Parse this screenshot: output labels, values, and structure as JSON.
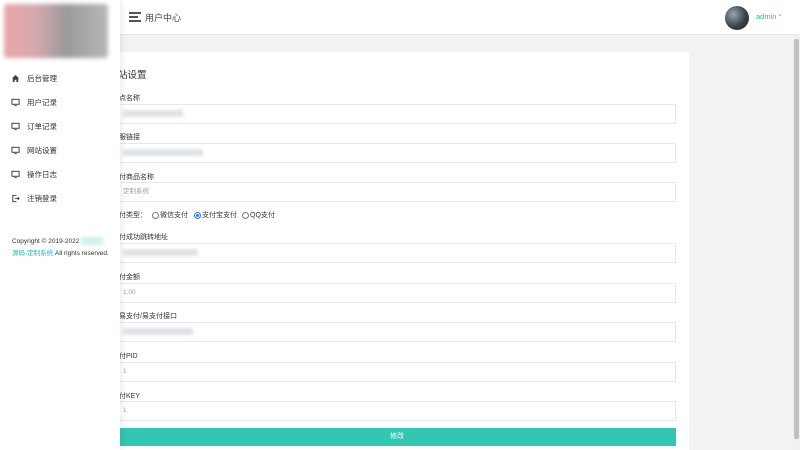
{
  "header": {
    "title": "用户中心",
    "user_name": "admin",
    "chevron": "⌄"
  },
  "sidebar": {
    "items": [
      {
        "label": "后台管理",
        "icon": "home-icon"
      },
      {
        "label": "用户记录",
        "icon": "monitor-icon"
      },
      {
        "label": "订单记录",
        "icon": "monitor-icon"
      },
      {
        "label": "网站设置",
        "icon": "monitor-icon"
      },
      {
        "label": "操作日志",
        "icon": "monitor-icon"
      },
      {
        "label": "注销登录",
        "icon": "logout-icon"
      }
    ],
    "copyright_prefix": "Copyright © 2019-2022",
    "copyright_link": "源码-定制系统",
    "copyright_suffix": " All rights reserved."
  },
  "form": {
    "title": "站设置",
    "site_name_label": "点名称",
    "service_link_label": "服链接",
    "product_name_label": "付商品名称",
    "product_name_value": "定制系统",
    "pay_type_label": "付类型：",
    "pay_options": [
      "微信支付",
      "支付宝支付",
      "QQ支付"
    ],
    "pay_selected": "支付宝支付",
    "redirect_label": "付成功跳转地址",
    "amount_label": "付金额",
    "amount_value": "1.00",
    "epay_label": "易支付/易支付接口",
    "pid_label": "付PID",
    "pid_value": "1",
    "key_label": "付KEY",
    "key_value": "1",
    "submit_label": "修改"
  },
  "colors": {
    "accent": "#33c6b3",
    "link": "#1fbfae",
    "radio_selected": "#2d7be5"
  }
}
